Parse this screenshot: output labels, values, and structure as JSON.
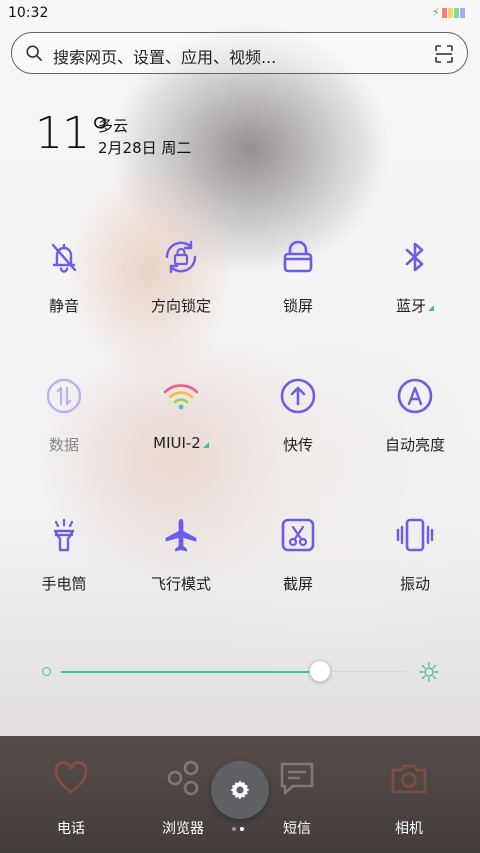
{
  "status_bar": {
    "time": "10:32"
  },
  "search": {
    "placeholder": "搜索网页、设置、应用、视频..."
  },
  "weather": {
    "temperature": "11°",
    "condition": "多云",
    "date": "2月28日 周二"
  },
  "toggles": [
    {
      "label": "静音",
      "icon": "bell-off-icon",
      "state": "on"
    },
    {
      "label": "方向锁定",
      "icon": "rotation-lock-icon",
      "state": "on"
    },
    {
      "label": "锁屏",
      "icon": "lock-icon",
      "state": "on"
    },
    {
      "label": "蓝牙",
      "icon": "bluetooth-icon",
      "state": "on"
    },
    {
      "label": "数据",
      "icon": "mobile-data-icon",
      "state": "off"
    },
    {
      "label": "MIUI-2",
      "icon": "wifi-icon",
      "state": "on"
    },
    {
      "label": "快传",
      "icon": "quick-transfer-icon",
      "state": "on"
    },
    {
      "label": "自动亮度",
      "icon": "auto-brightness-icon",
      "state": "on"
    },
    {
      "label": "手电筒",
      "icon": "flashlight-icon",
      "state": "on"
    },
    {
      "label": "飞行模式",
      "icon": "airplane-icon",
      "state": "on"
    },
    {
      "label": "截屏",
      "icon": "screenshot-icon",
      "state": "on"
    },
    {
      "label": "振动",
      "icon": "vibrate-icon",
      "state": "on"
    }
  ],
  "brightness": {
    "level": 0.75
  },
  "dock": [
    {
      "label": "电话",
      "icon": "phone-icon"
    },
    {
      "label": "浏览器",
      "icon": "browser-icon"
    },
    {
      "label": "短信",
      "icon": "message-icon"
    },
    {
      "label": "相机",
      "icon": "camera-icon"
    }
  ],
  "settings_button": {
    "icon": "gear-icon"
  },
  "page_indicator": {
    "count": 2,
    "active": 1
  },
  "colors": {
    "accent": "#6c5ce7",
    "slider": "#40c2b0",
    "disabled": "#b9b2ee"
  }
}
